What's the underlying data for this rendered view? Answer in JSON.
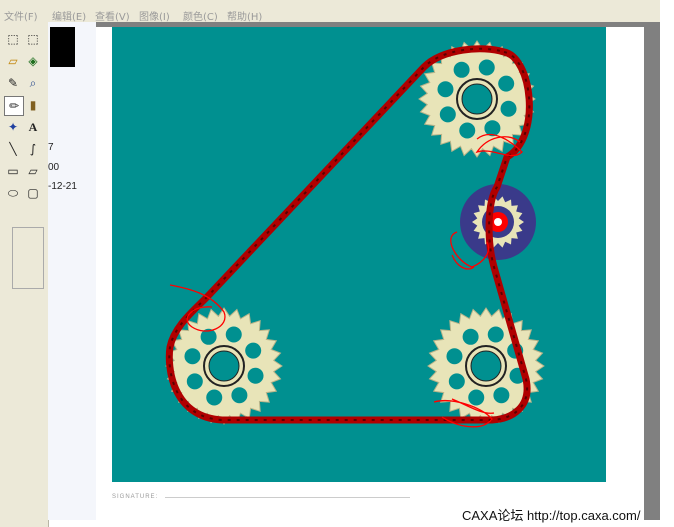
{
  "menubar": {
    "items": [
      {
        "label": "文件(F)"
      },
      {
        "label": "编辑(E)"
      },
      {
        "label": "查看(V)"
      },
      {
        "label": "图像(I)"
      },
      {
        "label": "颜色(C)"
      },
      {
        "label": "帮助(H)"
      }
    ]
  },
  "toolbox": {
    "tools": [
      {
        "name": "free-select-icon",
        "glyph": "⬚"
      },
      {
        "name": "rect-select-icon",
        "glyph": "⬚"
      },
      {
        "name": "eraser-icon",
        "glyph": "▱"
      },
      {
        "name": "fill-icon",
        "glyph": "◈"
      },
      {
        "name": "color-picker-icon",
        "glyph": "✎"
      },
      {
        "name": "magnifier-icon",
        "glyph": "⌕"
      },
      {
        "name": "pencil-icon",
        "glyph": "✏"
      },
      {
        "name": "brush-icon",
        "glyph": "▮"
      },
      {
        "name": "airbrush-icon",
        "glyph": "✦"
      },
      {
        "name": "text-icon",
        "glyph": "A"
      },
      {
        "name": "line-icon",
        "glyph": "╲"
      },
      {
        "name": "curve-icon",
        "glyph": "∫"
      },
      {
        "name": "rectangle-icon",
        "glyph": "▭"
      },
      {
        "name": "polygon-icon",
        "glyph": "▱"
      },
      {
        "name": "ellipse-icon",
        "glyph": "⬭"
      },
      {
        "name": "rounded-rect-icon",
        "glyph": "▢"
      }
    ]
  },
  "sidebar_info": {
    "line1": "7",
    "line2": "00",
    "line3": "-12-21"
  },
  "drawing": {
    "signature_label": "SIGNATURE:",
    "colors": {
      "background": "#009090",
      "chain": "#b00000",
      "sprocket": "#e8e4b8",
      "hole": "#009090",
      "tensioner": "#3a3a8a",
      "annotation": "#ff0000"
    }
  },
  "watermark": "CAXA论坛 http://top.caxa.com/"
}
